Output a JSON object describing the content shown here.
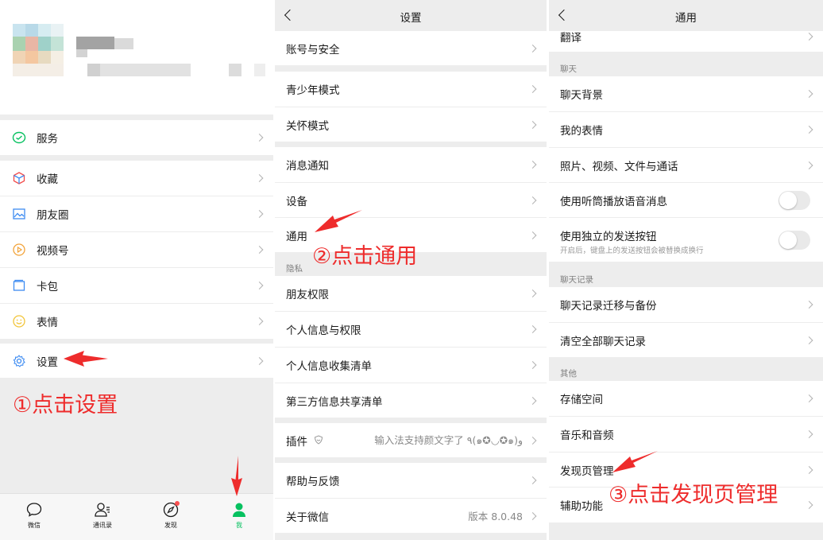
{
  "panel1": {
    "menu": [
      {
        "label": "服务",
        "icon": "service-icon"
      },
      {
        "label": "收藏",
        "icon": "favorites-icon"
      },
      {
        "label": "朋友圈",
        "icon": "moments-icon"
      },
      {
        "label": "视频号",
        "icon": "channels-icon"
      },
      {
        "label": "卡包",
        "icon": "card-wallet-icon"
      },
      {
        "label": "表情",
        "icon": "sticker-icon"
      },
      {
        "label": "设置",
        "icon": "settings-icon"
      }
    ],
    "tabs": [
      {
        "label": "微信",
        "icon": "chat-icon"
      },
      {
        "label": "通讯录",
        "icon": "contacts-icon"
      },
      {
        "label": "发现",
        "icon": "discover-icon"
      },
      {
        "label": "我",
        "icon": "me-icon"
      }
    ],
    "annotation": "①点击设置"
  },
  "panel2": {
    "title": "设置",
    "items": {
      "account": "账号与安全",
      "teen": "青少年模式",
      "care": "关怀模式",
      "notify": "消息通知",
      "device": "设备",
      "general": "通用",
      "privacy_section": "隐私",
      "friends_perm": "朋友权限",
      "personal_info": "个人信息与权限",
      "info_collect": "个人信息收集清单",
      "third_party": "第三方信息共享清单",
      "plugins": "插件",
      "plugins_value": "输入法支持颜文字了 ٩(๑✪◡✪๑)و",
      "help": "帮助与反馈",
      "about": "关于微信",
      "about_value": "版本 8.0.48"
    },
    "annotation": "②点击通用"
  },
  "panel3": {
    "title": "通用",
    "items": {
      "translate": "翻译",
      "chat_section": "聊天",
      "chat_bg": "聊天背景",
      "my_stickers": "我的表情",
      "media": "照片、视频、文件与通话",
      "earpiece": "使用听筒播放语音消息",
      "send_btn": "使用独立的发送按钮",
      "send_btn_desc": "开启后，键盘上的发送按钮会被替换成换行",
      "history_section": "聊天记录",
      "migrate": "聊天记录迁移与备份",
      "clear": "清空全部聊天记录",
      "other_section": "其他",
      "storage": "存储空间",
      "music": "音乐和音频",
      "discover_mgmt": "发现页管理",
      "accessibility": "辅助功能"
    },
    "annotation": "③点击发现页管理"
  },
  "colors": {
    "wechat_green": "#07c160",
    "annotation_red": "#ee2c2c",
    "background": "#ededed"
  }
}
